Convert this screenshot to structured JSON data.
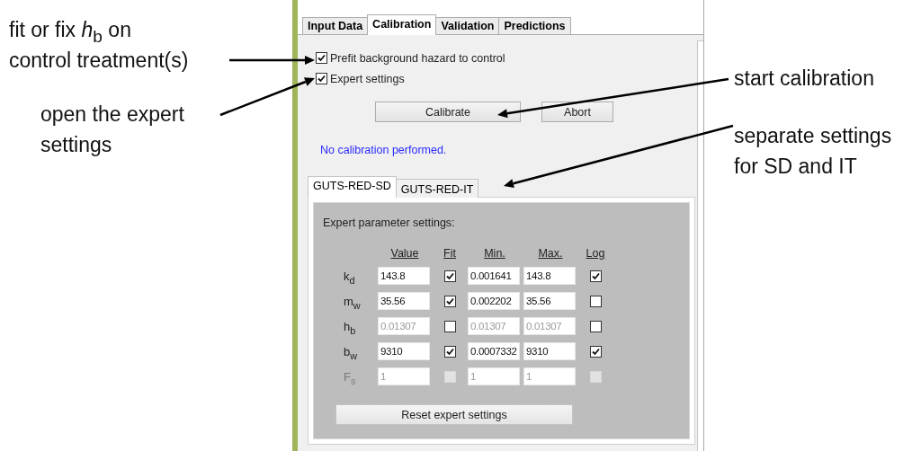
{
  "annotations_left": [
    {
      "lines": [
        "fit or fix *h*$_{b}$ on",
        "control treatment(s)"
      ]
    },
    {
      "lines": [
        "open the expert",
        "settings"
      ]
    }
  ],
  "annotations_right": [
    {
      "lines": [
        "start calibration"
      ]
    },
    {
      "lines": [
        "separate settings",
        "for SD and IT"
      ]
    }
  ],
  "tabs": [
    {
      "label": "Input Data",
      "selected": false
    },
    {
      "label": "Calibration",
      "selected": true
    },
    {
      "label": "Validation",
      "selected": false
    },
    {
      "label": "Predictions",
      "selected": false
    }
  ],
  "options": [
    {
      "label": "Prefit background hazard to control",
      "checked": true
    },
    {
      "label": "Expert settings",
      "checked": true
    }
  ],
  "buttons": [
    "Calibrate",
    "Abort"
  ],
  "status": "No calibration performed.",
  "model_tabs": [
    {
      "label": "GUTS-RED-SD",
      "selected": true
    },
    {
      "label": "GUTS-RED-IT",
      "selected": false
    }
  ],
  "expert": {
    "title": "Expert parameter settings:",
    "columns": [
      "Value",
      "Fit",
      "Min.",
      "Max.",
      "Log"
    ],
    "rows": [
      {
        "name": "k$_{d}$",
        "value": "143.8",
        "fit": true,
        "min": "0.001641",
        "max": "143.8",
        "log": true,
        "greyed": false,
        "disabled": false
      },
      {
        "name": "m$_{w}$",
        "value": "35.56",
        "fit": true,
        "min": "0.002202",
        "max": "35.56",
        "log": false,
        "greyed": false,
        "disabled": false
      },
      {
        "name": "h$_{b}$",
        "value": "0.01307",
        "fit": false,
        "min": "0.01307",
        "max": "0.01307",
        "log": false,
        "greyed": true,
        "disabled": false
      },
      {
        "name": "b$_{w}$",
        "value": "9310",
        "fit": true,
        "min": "0.0007332",
        "max": "9310",
        "log": true,
        "greyed": false,
        "disabled": false
      },
      {
        "name": "F$_{s}$",
        "value": "1",
        "fit": false,
        "min": "1",
        "max": "1",
        "log": false,
        "greyed": true,
        "disabled": true
      }
    ],
    "reset_button": "Reset expert settings"
  }
}
